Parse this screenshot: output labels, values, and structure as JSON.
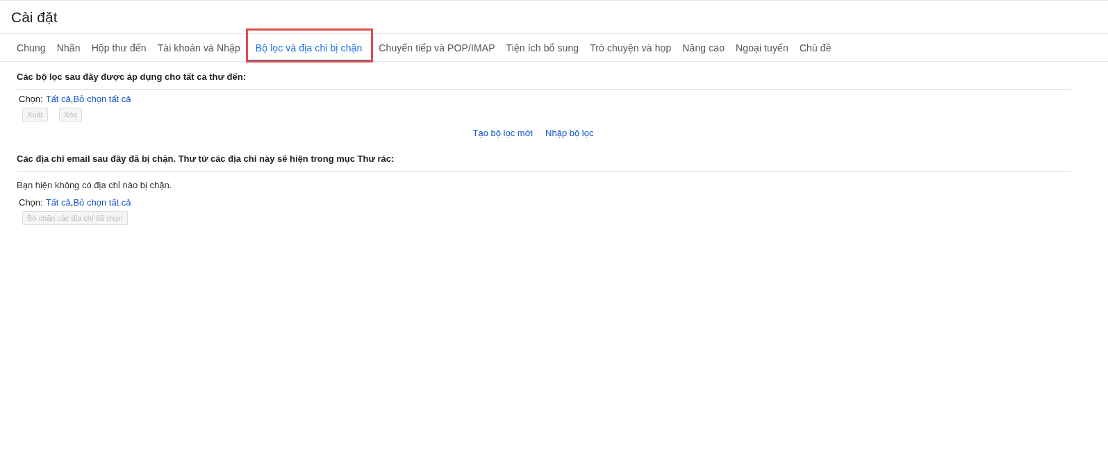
{
  "title": "Cài đặt",
  "tabs": [
    {
      "label": "Chung",
      "selected": false,
      "highlighted": false
    },
    {
      "label": "Nhãn",
      "selected": false,
      "highlighted": false
    },
    {
      "label": "Hộp thư đến",
      "selected": false,
      "highlighted": false
    },
    {
      "label": "Tài khoản và Nhập",
      "selected": false,
      "highlighted": false
    },
    {
      "label": "Bộ lọc và địa chỉ bị chặn",
      "selected": true,
      "highlighted": true
    },
    {
      "label": "Chuyển tiếp và POP/IMAP",
      "selected": false,
      "highlighted": false
    },
    {
      "label": "Tiện ích bổ sung",
      "selected": false,
      "highlighted": false
    },
    {
      "label": "Trò chuyện và họp",
      "selected": false,
      "highlighted": false
    },
    {
      "label": "Nâng cao",
      "selected": false,
      "highlighted": false
    },
    {
      "label": "Ngoại tuyến",
      "selected": false,
      "highlighted": false
    },
    {
      "label": "Chủ đề",
      "selected": false,
      "highlighted": false
    }
  ],
  "filters": {
    "heading": "Các bộ lọc sau đây được áp dụng cho tất cả thư đến:",
    "select": {
      "label": "Chọn:",
      "all": "Tất cả",
      "separator": ",",
      "none": "Bỏ chọn tất cả"
    },
    "buttons": [
      {
        "label": "Xuất",
        "disabled": true
      },
      {
        "label": "Xóa",
        "disabled": true
      }
    ],
    "links": [
      "Tạo bộ lọc mới",
      "Nhập bộ lọc"
    ]
  },
  "blocked": {
    "heading": "Các địa chỉ email sau đây đã bị chặn. Thư từ các địa chỉ này sẽ hiện trong mục Thư rác:",
    "message": "Bạn hiện không có địa chỉ nào bị chặn.",
    "select": {
      "label": "Chọn:",
      "all": "Tất cả",
      "separator": ",",
      "none": "Bỏ chọn tất cả"
    },
    "buttons": [
      {
        "label": "Bỏ chặn các địa chỉ đã chọn",
        "disabled": true
      }
    ]
  }
}
